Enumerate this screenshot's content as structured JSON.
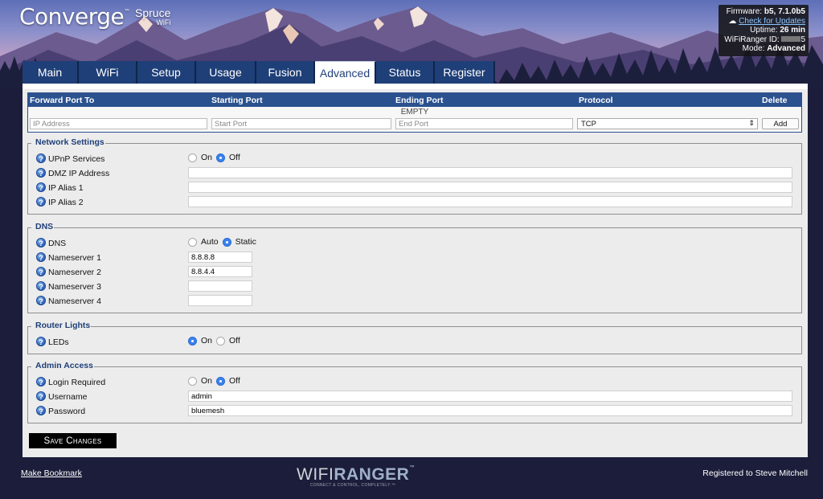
{
  "brand": {
    "logo": "Converge",
    "trademark": "™",
    "edition": "Spruce",
    "edition_sub": "WiFi"
  },
  "info": {
    "firmware_label": "Firmware:",
    "firmware_value": "b5, 7.1.0b5",
    "check_updates": "Check for Updates",
    "uptime_label": "Uptime:",
    "uptime_value": "26 min",
    "ranger_id_label": "WiFiRanger ID:",
    "ranger_id_suffix": "5",
    "mode_label": "Mode:",
    "mode_value": "Advanced"
  },
  "tabs": [
    {
      "label": "Main"
    },
    {
      "label": "WiFi"
    },
    {
      "label": "Setup"
    },
    {
      "label": "Usage"
    },
    {
      "label": "Fusion"
    },
    {
      "label": "Advanced",
      "active": true
    },
    {
      "label": "Status"
    },
    {
      "label": "Register"
    }
  ],
  "port_forward": {
    "columns": [
      "Forward Port To",
      "Starting Port",
      "Ending Port",
      "Protocol",
      "Delete"
    ],
    "empty_text": "EMPTY",
    "ip_placeholder": "IP Address",
    "start_placeholder": "Start Port",
    "end_placeholder": "End Port",
    "protocol": "TCP",
    "add_label": "Add"
  },
  "network_settings": {
    "legend": "Network Settings",
    "upnp_label": "UPnP Services",
    "upnp_on": "On",
    "upnp_off": "Off",
    "upnp_value": "Off",
    "dmz_label": "DMZ IP Address",
    "dmz_value": "",
    "alias1_label": "IP Alias 1",
    "alias1_value": "",
    "alias2_label": "IP Alias 2",
    "alias2_value": ""
  },
  "dns": {
    "legend": "DNS",
    "dns_label": "DNS",
    "auto": "Auto",
    "static": "Static",
    "mode_value": "Static",
    "ns1_label": "Nameserver 1",
    "ns1_value": "8.8.8.8",
    "ns2_label": "Nameserver 2",
    "ns2_value": "8.8.4.4",
    "ns3_label": "Nameserver 3",
    "ns3_value": "",
    "ns4_label": "Nameserver 4",
    "ns4_value": ""
  },
  "router_lights": {
    "legend": "Router Lights",
    "leds_label": "LEDs",
    "on": "On",
    "off": "Off",
    "value": "On"
  },
  "admin": {
    "legend": "Admin Access",
    "login_label": "Login Required",
    "on": "On",
    "off": "Off",
    "login_value": "Off",
    "username_label": "Username",
    "username_value": "admin",
    "password_label": "Password",
    "password_value": "bluemesh"
  },
  "save_label": "Save Changes",
  "footer": {
    "bookmark": "Make Bookmark",
    "logo_wifi": "WIFI",
    "logo_ranger": "RANGER",
    "logo_tm": "™",
    "logo_tagline": "CONNECT & CONTROL, COMPLETELY.™",
    "registered": "Registered to Steve Mitchell"
  },
  "colors": {
    "tab_blue": "#1f3f78",
    "header_blue": "#2b528f",
    "legend_blue": "#1f3f78",
    "radio_on": "#3a83ee",
    "background": "#1b1d3a"
  }
}
